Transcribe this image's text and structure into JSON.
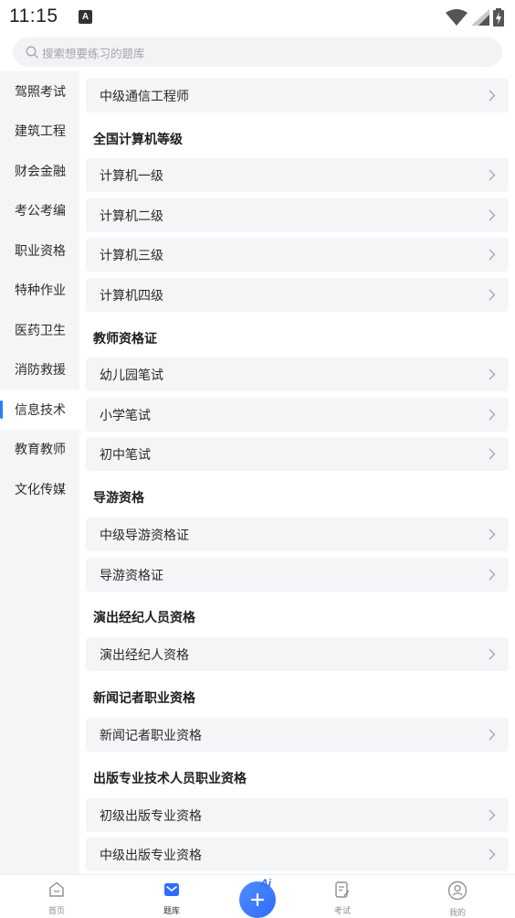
{
  "status_bar": {
    "time": "11:15",
    "notification_icon": "A"
  },
  "search": {
    "placeholder": "搜索想要练习的题库"
  },
  "sidebar": {
    "items": [
      {
        "label": "驾照考试"
      },
      {
        "label": "建筑工程"
      },
      {
        "label": "财会金融"
      },
      {
        "label": "考公考编"
      },
      {
        "label": "职业资格"
      },
      {
        "label": "特种作业"
      },
      {
        "label": "医药卫生"
      },
      {
        "label": "消防救援"
      },
      {
        "label": "信息技术",
        "active": true
      },
      {
        "label": "教育教师"
      },
      {
        "label": "文化传媒"
      }
    ]
  },
  "main": {
    "top_row": {
      "label": "中级通信工程师"
    },
    "sections": [
      {
        "title": "全国计算机等级",
        "rows": [
          "计算机一级",
          "计算机二级",
          "计算机三级",
          "计算机四级"
        ]
      },
      {
        "title": "教师资格证",
        "rows": [
          "幼儿园笔试",
          "小学笔试",
          "初中笔试"
        ]
      },
      {
        "title": "导游资格",
        "rows": [
          "中级导游资格证",
          "导游资格证"
        ]
      },
      {
        "title": "演出经纪人员资格",
        "rows": [
          "演出经纪人资格"
        ]
      },
      {
        "title": "新闻记者职业资格",
        "rows": [
          "新闻记者职业资格"
        ]
      },
      {
        "title": "出版专业技术人员职业资格",
        "rows": [
          "初级出版专业资格",
          "中级出版专业资格"
        ]
      }
    ]
  },
  "bottom_nav": {
    "home": "首页",
    "question_bank": "题库",
    "exam": "考试",
    "mine": "我的",
    "fab_badge": "Ai"
  },
  "colors": {
    "accent": "#2f7bff",
    "row_bg": "#f4f5f7",
    "sidebar_bg": "#f4f5f7"
  }
}
